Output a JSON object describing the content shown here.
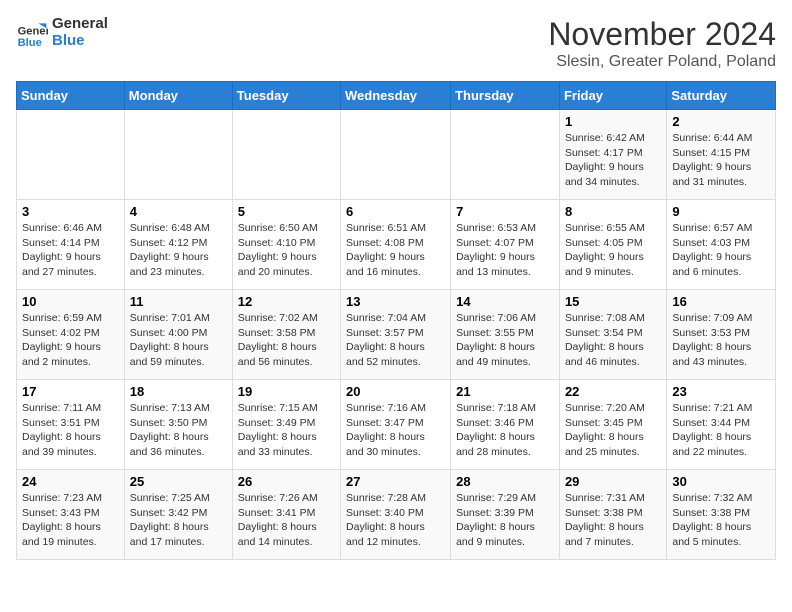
{
  "logo": {
    "text_general": "General",
    "text_blue": "Blue"
  },
  "title": "November 2024",
  "location": "Slesin, Greater Poland, Poland",
  "headers": [
    "Sunday",
    "Monday",
    "Tuesday",
    "Wednesday",
    "Thursday",
    "Friday",
    "Saturday"
  ],
  "weeks": [
    [
      {
        "day": "",
        "info": ""
      },
      {
        "day": "",
        "info": ""
      },
      {
        "day": "",
        "info": ""
      },
      {
        "day": "",
        "info": ""
      },
      {
        "day": "",
        "info": ""
      },
      {
        "day": "1",
        "info": "Sunrise: 6:42 AM\nSunset: 4:17 PM\nDaylight: 9 hours and 34 minutes."
      },
      {
        "day": "2",
        "info": "Sunrise: 6:44 AM\nSunset: 4:15 PM\nDaylight: 9 hours and 31 minutes."
      }
    ],
    [
      {
        "day": "3",
        "info": "Sunrise: 6:46 AM\nSunset: 4:14 PM\nDaylight: 9 hours and 27 minutes."
      },
      {
        "day": "4",
        "info": "Sunrise: 6:48 AM\nSunset: 4:12 PM\nDaylight: 9 hours and 23 minutes."
      },
      {
        "day": "5",
        "info": "Sunrise: 6:50 AM\nSunset: 4:10 PM\nDaylight: 9 hours and 20 minutes."
      },
      {
        "day": "6",
        "info": "Sunrise: 6:51 AM\nSunset: 4:08 PM\nDaylight: 9 hours and 16 minutes."
      },
      {
        "day": "7",
        "info": "Sunrise: 6:53 AM\nSunset: 4:07 PM\nDaylight: 9 hours and 13 minutes."
      },
      {
        "day": "8",
        "info": "Sunrise: 6:55 AM\nSunset: 4:05 PM\nDaylight: 9 hours and 9 minutes."
      },
      {
        "day": "9",
        "info": "Sunrise: 6:57 AM\nSunset: 4:03 PM\nDaylight: 9 hours and 6 minutes."
      }
    ],
    [
      {
        "day": "10",
        "info": "Sunrise: 6:59 AM\nSunset: 4:02 PM\nDaylight: 9 hours and 2 minutes."
      },
      {
        "day": "11",
        "info": "Sunrise: 7:01 AM\nSunset: 4:00 PM\nDaylight: 8 hours and 59 minutes."
      },
      {
        "day": "12",
        "info": "Sunrise: 7:02 AM\nSunset: 3:58 PM\nDaylight: 8 hours and 56 minutes."
      },
      {
        "day": "13",
        "info": "Sunrise: 7:04 AM\nSunset: 3:57 PM\nDaylight: 8 hours and 52 minutes."
      },
      {
        "day": "14",
        "info": "Sunrise: 7:06 AM\nSunset: 3:55 PM\nDaylight: 8 hours and 49 minutes."
      },
      {
        "day": "15",
        "info": "Sunrise: 7:08 AM\nSunset: 3:54 PM\nDaylight: 8 hours and 46 minutes."
      },
      {
        "day": "16",
        "info": "Sunrise: 7:09 AM\nSunset: 3:53 PM\nDaylight: 8 hours and 43 minutes."
      }
    ],
    [
      {
        "day": "17",
        "info": "Sunrise: 7:11 AM\nSunset: 3:51 PM\nDaylight: 8 hours and 39 minutes."
      },
      {
        "day": "18",
        "info": "Sunrise: 7:13 AM\nSunset: 3:50 PM\nDaylight: 8 hours and 36 minutes."
      },
      {
        "day": "19",
        "info": "Sunrise: 7:15 AM\nSunset: 3:49 PM\nDaylight: 8 hours and 33 minutes."
      },
      {
        "day": "20",
        "info": "Sunrise: 7:16 AM\nSunset: 3:47 PM\nDaylight: 8 hours and 30 minutes."
      },
      {
        "day": "21",
        "info": "Sunrise: 7:18 AM\nSunset: 3:46 PM\nDaylight: 8 hours and 28 minutes."
      },
      {
        "day": "22",
        "info": "Sunrise: 7:20 AM\nSunset: 3:45 PM\nDaylight: 8 hours and 25 minutes."
      },
      {
        "day": "23",
        "info": "Sunrise: 7:21 AM\nSunset: 3:44 PM\nDaylight: 8 hours and 22 minutes."
      }
    ],
    [
      {
        "day": "24",
        "info": "Sunrise: 7:23 AM\nSunset: 3:43 PM\nDaylight: 8 hours and 19 minutes."
      },
      {
        "day": "25",
        "info": "Sunrise: 7:25 AM\nSunset: 3:42 PM\nDaylight: 8 hours and 17 minutes."
      },
      {
        "day": "26",
        "info": "Sunrise: 7:26 AM\nSunset: 3:41 PM\nDaylight: 8 hours and 14 minutes."
      },
      {
        "day": "27",
        "info": "Sunrise: 7:28 AM\nSunset: 3:40 PM\nDaylight: 8 hours and 12 minutes."
      },
      {
        "day": "28",
        "info": "Sunrise: 7:29 AM\nSunset: 3:39 PM\nDaylight: 8 hours and 9 minutes."
      },
      {
        "day": "29",
        "info": "Sunrise: 7:31 AM\nSunset: 3:38 PM\nDaylight: 8 hours and 7 minutes."
      },
      {
        "day": "30",
        "info": "Sunrise: 7:32 AM\nSunset: 3:38 PM\nDaylight: 8 hours and 5 minutes."
      }
    ]
  ]
}
